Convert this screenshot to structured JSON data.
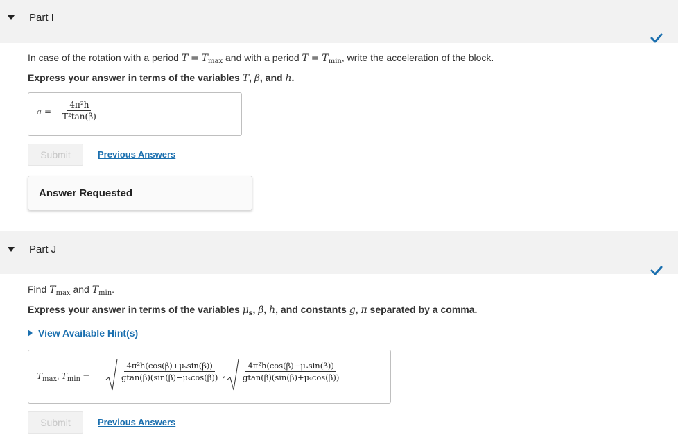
{
  "colors": {
    "header_bg": "#f2f2f2",
    "link": "#1a6faf",
    "check": "#1a6faf"
  },
  "part_i": {
    "title": "Part I",
    "prompt_1": "In case of the rotation with a period ",
    "prompt_2": " and with a period ",
    "prompt_3": ", write the acceleration of the block.",
    "instruction_1": "Express your answer in terms of the variables ",
    "instruction_2": ", and ",
    "instruction_3": ".",
    "answer_label": "a =",
    "answer_numerator": "4π²h",
    "answer_denominator": "T²tan(β)",
    "submit_label": "Submit",
    "previous_answers": "Previous Answers",
    "status": "Answer Requested",
    "status_icon": "check-icon"
  },
  "part_j": {
    "title": "Part J",
    "prompt_1": "Find ",
    "prompt_2": " and ",
    "prompt_3": ".",
    "instruction_1": "Express your answer in terms of the variables ",
    "instruction_2": ", and constants ",
    "instruction_3": " separated by a comma.",
    "hint": "View Available Hint(s)",
    "answer_num_1": "4π²h(cos(β)+μₛsin(β))",
    "answer_den_1": "gtan(β)(sin(β)−μₛcos(β))",
    "answer_num_2": "4π²h(cos(β)−μₛsin(β))",
    "answer_den_2": "gtan(β)(sin(β)+μₛcos(β))",
    "submit_label": "Submit",
    "previous_answers": "Previous Answers",
    "status_icon": "check-icon"
  }
}
